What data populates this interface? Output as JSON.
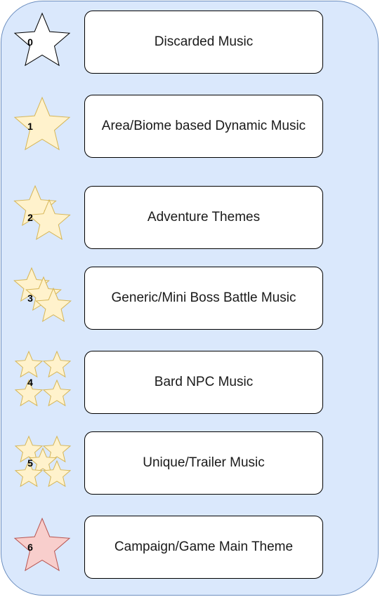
{
  "star_colors": {
    "outline": {
      "fill": "#ffffff",
      "stroke": "#000000"
    },
    "gold": {
      "fill": "#fff2cc",
      "stroke": "#d6b656"
    },
    "red": {
      "fill": "#f8cecc",
      "stroke": "#b85450"
    }
  },
  "tiers": [
    {
      "level": "0",
      "label": "Discarded Music",
      "star_style": "outline",
      "star_count": 1
    },
    {
      "level": "1",
      "label": "Area/Biome based Dynamic Music",
      "star_style": "gold",
      "star_count": 1
    },
    {
      "level": "2",
      "label": "Adventure Themes",
      "star_style": "gold",
      "star_count": 2
    },
    {
      "level": "3",
      "label": "Generic/Mini Boss Battle Music",
      "star_style": "gold",
      "star_count": 3
    },
    {
      "level": "4",
      "label": "Bard NPC Music",
      "star_style": "gold",
      "star_count": 4
    },
    {
      "level": "5",
      "label": "Unique/Trailer Music",
      "star_style": "gold",
      "star_count": 5
    },
    {
      "level": "6",
      "label": "Campaign/Game Main Theme",
      "star_style": "red",
      "star_count": 1
    }
  ]
}
